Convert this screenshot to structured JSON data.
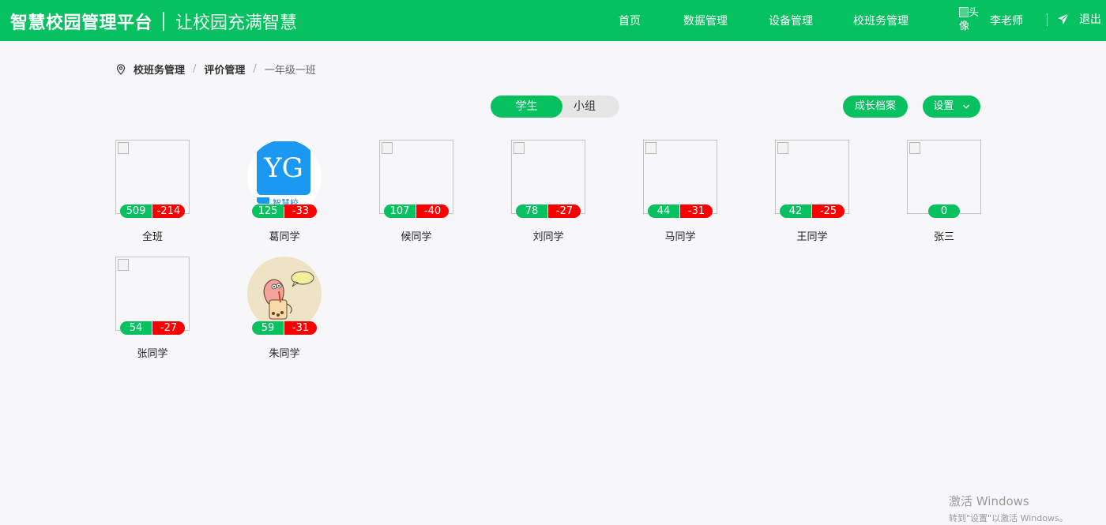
{
  "header": {
    "app_name": "智慧校园管理平台",
    "slogan": "让校园充满智慧",
    "nav": [
      "首页",
      "数据管理",
      "设备管理",
      "校班务管理"
    ],
    "avatar_alt_1": "头",
    "avatar_alt_2": "像",
    "username": "李老师",
    "logout": "退出"
  },
  "breadcrumb": {
    "items": [
      "校班务管理",
      "评价管理",
      "一年级一班"
    ],
    "separator": "/"
  },
  "tabs": {
    "active": "学生",
    "inactive": "小组"
  },
  "buttons": {
    "growth_archive": "成长档案",
    "settings": "设置"
  },
  "students": [
    {
      "name": "全班",
      "plus": "509",
      "minus": "-214"
    },
    {
      "name": "葛同学",
      "plus": "125",
      "minus": "-33"
    },
    {
      "name": "候同学",
      "plus": "107",
      "minus": "-40"
    },
    {
      "name": "刘同学",
      "plus": "78",
      "minus": "-27"
    },
    {
      "name": "马同学",
      "plus": "44",
      "minus": "-31"
    },
    {
      "name": "王同学",
      "plus": "42",
      "minus": "-25"
    },
    {
      "name": "张三",
      "plus": "0"
    },
    {
      "name": "张同学",
      "plus": "54",
      "minus": "-27"
    },
    {
      "name": "朱同学",
      "plus": "59",
      "minus": "-31"
    }
  ],
  "avatar_logo": {
    "letters": "YG",
    "caption": "智慧校"
  },
  "watermark": {
    "line1": "激活 Windows",
    "line2": "转到\"设置\"以激活 Windows。"
  },
  "colors": {
    "primary": "#07c160",
    "negative": "#fa0000"
  }
}
